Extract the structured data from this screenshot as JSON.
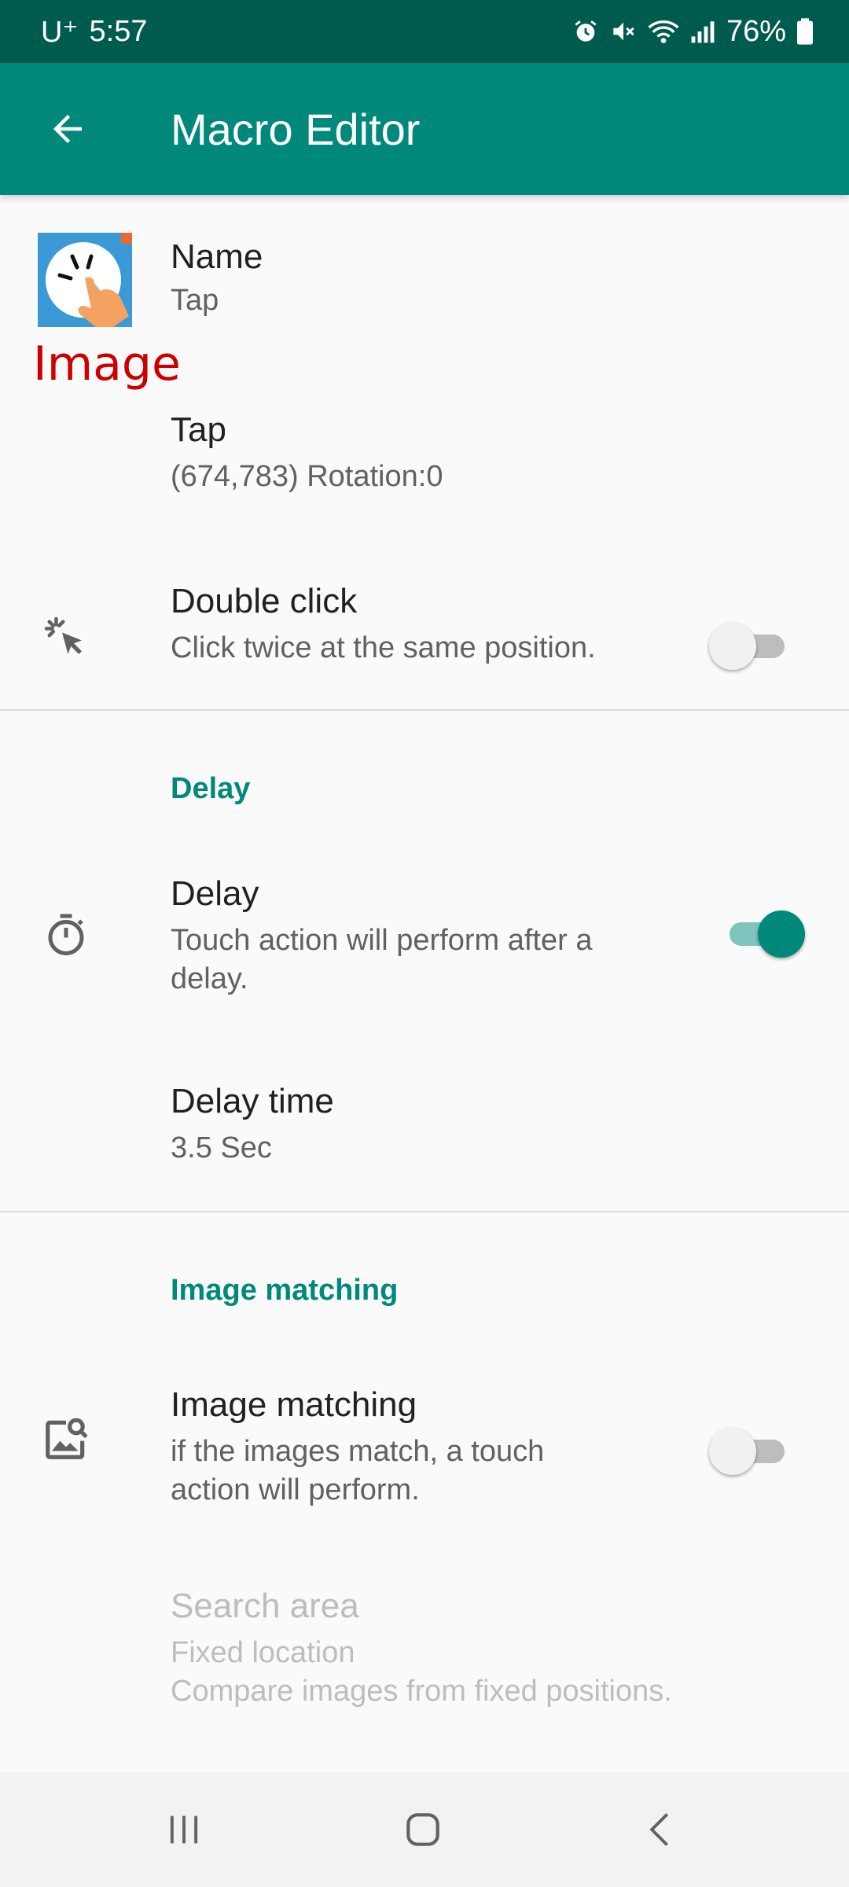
{
  "status_bar": {
    "carrier": "U⁺",
    "time": "5:57",
    "battery": "76%",
    "icons": [
      "alarm-icon",
      "mute-icon",
      "wifi-icon",
      "signal-icon",
      "battery-icon"
    ]
  },
  "app_bar": {
    "title": "Macro Editor",
    "back_icon": "arrow-back-icon"
  },
  "name_pref": {
    "title": "Name",
    "summary": "Tap",
    "icon": "tap-app-icon"
  },
  "overlay_label": "Image",
  "tap_pref": {
    "title": "Tap",
    "summary": "(674,783) Rotation:0"
  },
  "double_click": {
    "title": "Double click",
    "summary": "Click twice at the same position.",
    "icon": "click-cursor-icon",
    "enabled": false
  },
  "delay_section": {
    "header": "Delay",
    "delay": {
      "title": "Delay",
      "summary_line1": "Touch action will perform after a",
      "summary_line2": "delay.",
      "icon": "timer-icon",
      "enabled": true
    },
    "delay_time": {
      "title": "Delay time",
      "summary": "3.5 Sec"
    }
  },
  "image_matching_section": {
    "header": "Image matching",
    "image_matching": {
      "title": "Image matching",
      "summary_line1": "if the images match, a touch",
      "summary_line2": "action will perform.",
      "icon": "image-search-icon",
      "enabled": false
    },
    "search_area": {
      "title": "Search area",
      "summary_line1": "Fixed location",
      "summary_line2": "Compare images from fixed positions."
    }
  },
  "nav_bar": {
    "icons": [
      "recents-icon",
      "home-icon",
      "back-nav-icon"
    ]
  },
  "colors": {
    "primary": "#00897b",
    "primary_dark": "#005b4f",
    "accent_label": "#cc0000"
  }
}
